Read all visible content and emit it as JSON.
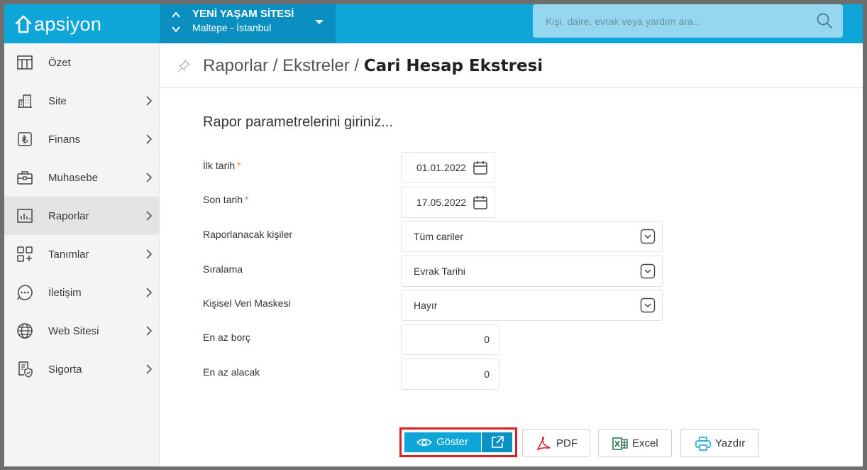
{
  "brand": {
    "name": "apsiyon"
  },
  "site": {
    "name": "YENİ YAŞAM SİTESİ",
    "location": "Maltepe - İstanbul"
  },
  "search": {
    "placeholder": "Kişi, daire, evrak veya yardım ara..."
  },
  "sidebar": {
    "items": [
      {
        "label": "Özet",
        "icon": "table-icon",
        "has_chevron": false,
        "active": false
      },
      {
        "label": "Site",
        "icon": "building-icon",
        "has_chevron": true,
        "active": false
      },
      {
        "label": "Finans",
        "icon": "lira-icon",
        "has_chevron": true,
        "active": false
      },
      {
        "label": "Muhasebe",
        "icon": "briefcase-icon",
        "has_chevron": true,
        "active": false
      },
      {
        "label": "Raporlar",
        "icon": "bar-chart-icon",
        "has_chevron": true,
        "active": true
      },
      {
        "label": "Tanımlar",
        "icon": "grid-plus-icon",
        "has_chevron": true,
        "active": false
      },
      {
        "label": "İletişim",
        "icon": "chat-icon",
        "has_chevron": true,
        "active": false
      },
      {
        "label": "Web Sitesi",
        "icon": "globe-icon",
        "has_chevron": true,
        "active": false
      },
      {
        "label": "Sigorta",
        "icon": "insurance-doc-icon",
        "has_chevron": true,
        "active": false
      }
    ]
  },
  "breadcrumb": {
    "part1": "Raporlar",
    "part2": "Ekstreler",
    "current": "Cari Hesap Ekstresi",
    "separator": "/"
  },
  "form": {
    "title": "Rapor parametrelerini giriniz...",
    "required_mark": "*",
    "start_date": {
      "label": "İlk tarih",
      "value": "01.01.2022"
    },
    "end_date": {
      "label": "Son tarih",
      "value": "17.05.2022"
    },
    "persons": {
      "label": "Raporlanacak kişiler",
      "value": "Tüm cariler"
    },
    "sorting": {
      "label": "Sıralama",
      "value": "Evrak Tarihi"
    },
    "mask": {
      "label": "Kişisel Veri Maskesi",
      "value": "Hayır"
    },
    "min_debt": {
      "label": "En az borç",
      "value": "0"
    },
    "min_credit": {
      "label": "En az alacak",
      "value": "0"
    }
  },
  "buttons": {
    "show": "Göster",
    "pdf": "PDF",
    "excel": "Excel",
    "print": "Yazdır"
  },
  "colors": {
    "accent": "#0ea5d8",
    "highlight_outline": "#d61f26",
    "required": "#f07a4d",
    "pdf": "#d61f26",
    "excel": "#1d7044",
    "print": "#0ea5d8"
  }
}
